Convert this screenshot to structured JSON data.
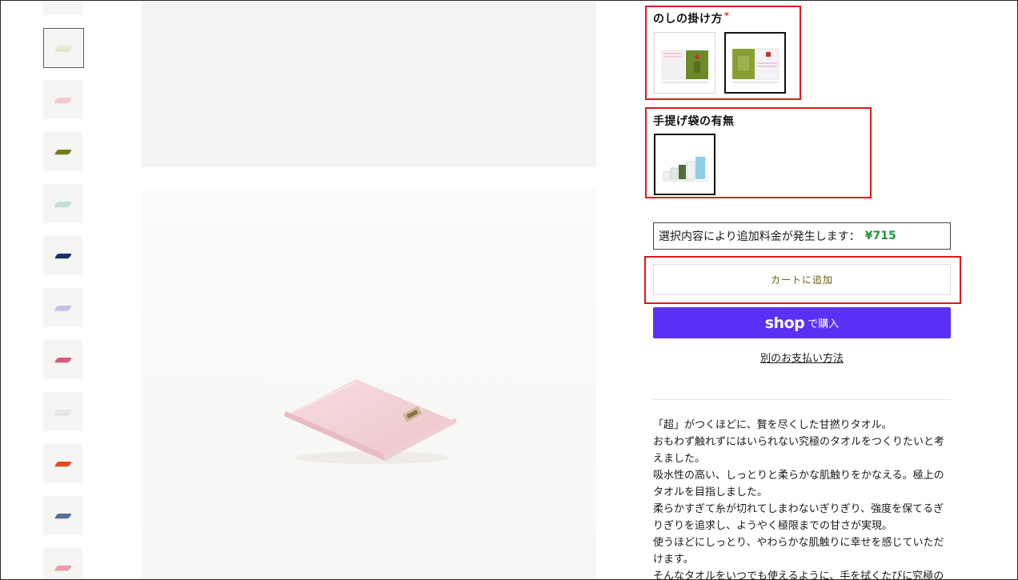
{
  "thumbnails": [
    {
      "color": "#f2ede4",
      "active": false
    },
    {
      "color": "#efe6d6",
      "active": true
    },
    {
      "color": "#f6c9d2",
      "active": false
    },
    {
      "color": "#7a7a1c",
      "active": false
    },
    {
      "color": "#bfe0d8",
      "active": false
    },
    {
      "color": "#1e2f62",
      "active": false
    },
    {
      "color": "#c9bfe6",
      "active": false
    },
    {
      "color": "#d95a78",
      "active": false
    },
    {
      "color": "#e8e8e6",
      "active": false
    },
    {
      "color": "#e8471f",
      "active": false
    },
    {
      "color": "#5a6f98",
      "active": false
    },
    {
      "color": "#f29aa8",
      "active": false
    }
  ],
  "noshi": {
    "title": "のしの掛け方",
    "required_mark": "*"
  },
  "bag": {
    "title": "手提げ袋の有無"
  },
  "price_note": {
    "label": "選択内容により追加料金が発生します：",
    "amount": "¥715"
  },
  "cart_button": "カートに追加",
  "shop_pay": {
    "logo": "shop",
    "label": "で購入"
  },
  "alt_payment": "別のお支払い方法",
  "description": [
    "「超」がつくほどに、贅を尽くした甘撚りタオル。",
    "おもわず触れずにはいられない究極のタオルをつくりたいと考",
    "えました。",
    "吸水性の高い、しっとりと柔らかな肌触りをかなえる。極上の",
    "タオルを目指しました。",
    "柔らかすぎて糸が切れてしまわないぎりぎり、強度を保てるぎ",
    "りぎりを追求し、ようやく極限までの甘さが実現。",
    "使うほどにしっとり、やわらかな肌触りに幸せを感じていただ",
    "けます。",
    "そんなタオルをいつでも使えるように、手を拭くたびに究極の"
  ],
  "colors": {
    "highlight_box": "#e0191b",
    "shop_pay": "#5a31f4",
    "price_amount": "#1a9a3a",
    "main_towel": "#f3d3d6"
  }
}
